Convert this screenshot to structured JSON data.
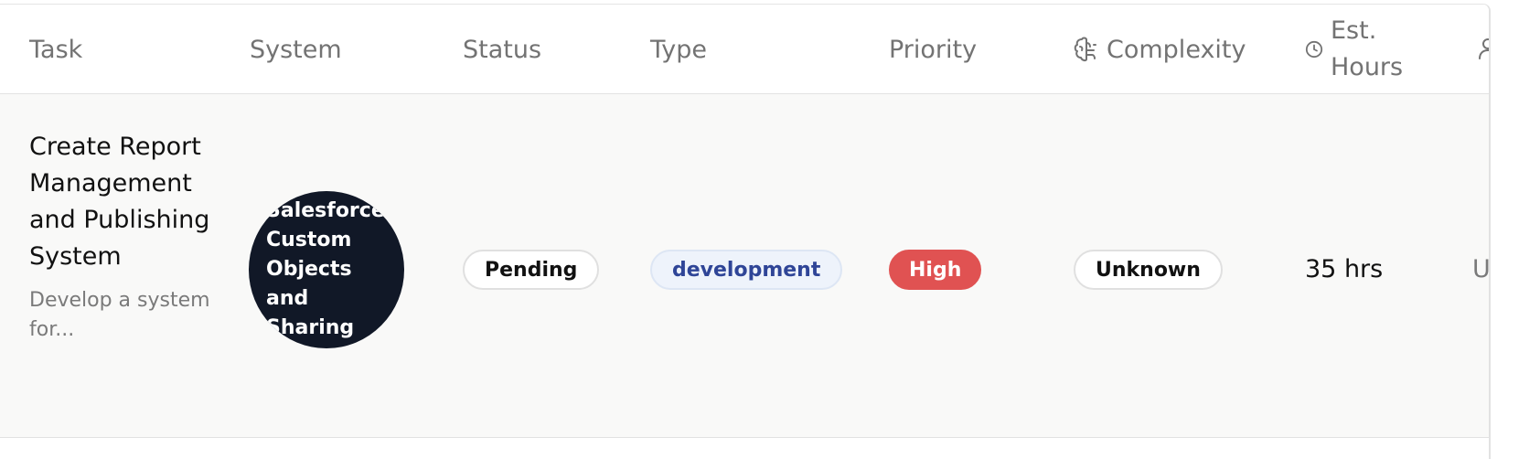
{
  "table": {
    "columns": {
      "task": "Task",
      "system": "System",
      "status": "Status",
      "type": "Type",
      "priority": "Priority",
      "complexity": "Complexity",
      "est_hours": "Est. Hours"
    },
    "column_icons": {
      "complexity": "brain-icon",
      "est_hours": "clock-icon",
      "owner": "user-icon"
    },
    "rows": [
      {
        "task_title": "Create Report Management and Publishing System",
        "task_description": "Develop a system for...",
        "system": "Salesforce Custom Objects and Sharing",
        "status": "Pending",
        "type": "development",
        "priority": "High",
        "complexity": "Unknown",
        "est_hours": "35 hrs",
        "owner": "U"
      }
    ]
  },
  "colors": {
    "priority_high": "#e05252",
    "type_badge_text": "#2f4597",
    "system_badge_bg": "#111827",
    "row_bg": "#f9f9f8"
  }
}
